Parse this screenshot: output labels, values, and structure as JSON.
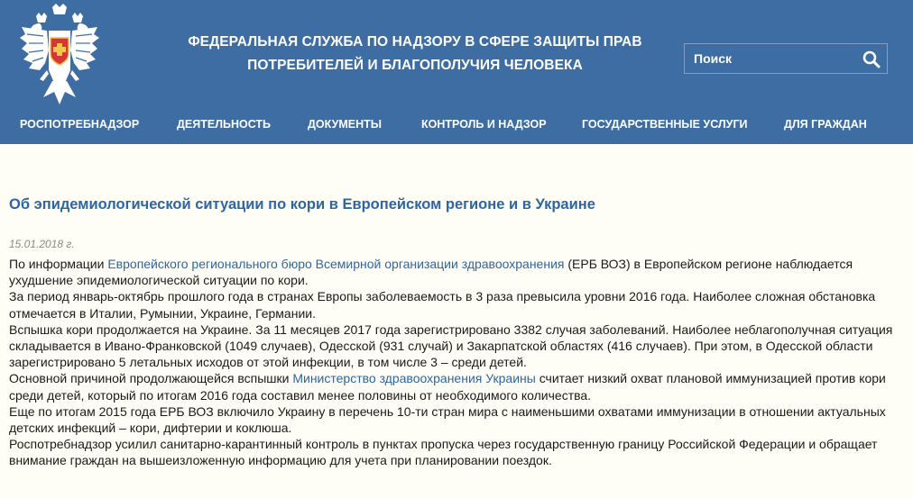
{
  "header": {
    "title_line1": "ФЕДЕРАЛЬНАЯ СЛУЖБА ПО НАДЗОРУ В СФЕРЕ ЗАЩИТЫ ПРАВ",
    "title_line2": "ПОТРЕБИТЕЛЕЙ И БЛАГОПОЛУЧИЯ ЧЕЛОВЕКА",
    "search_placeholder": "Поиск",
    "emblem_icon": "double-headed-eagle-emblem-icon",
    "search_icon": "search-icon",
    "colors": {
      "header_bg": "#3e6da3",
      "link": "#2f65a1",
      "page_bg": "#fefdf6"
    }
  },
  "nav": {
    "items": [
      {
        "label": "РОСПОТРЕБНАДЗОР"
      },
      {
        "label": "ДЕЯТЕЛЬНОСТЬ"
      },
      {
        "label": "ДОКУМЕНТЫ"
      },
      {
        "label": "КОНТРОЛЬ И НАДЗОР"
      },
      {
        "label": "ГОСУДАРСТВЕННЫЕ УСЛУГИ"
      },
      {
        "label": "ДЛЯ ГРАЖДАН"
      }
    ]
  },
  "article": {
    "title": "Об эпидемиологической ситуации по кори в Европейском регионе и в Украине",
    "date": "15.01.2018 г.",
    "p1_before": "По информации ",
    "p1_link": "Европейского регионального бюро Всемирной организации здравоохранения",
    "p1_after": " (ЕРБ ВОЗ) в Европейском регионе наблюдается ухудшение эпидемиологической ситуации по кори.",
    "p2": "За период январь-октябрь прошлого года в странах Европы заболеваемость в 3 раза превысила уровни 2016 года. Наиболее сложная обстановка отмечается в Италии, Румынии, Украине, Германии.",
    "p3": "Вспышка кори продолжается на Украине. За 11 месяцев 2017 года зарегистрировано 3382 случая заболеваний. Наиболее неблагополучная ситуация складывается в Ивано-Франковской (1049 случаев), Одесской (931 случай) и Закарпатской областях (416 случаев). При этом, в Одесской области зарегистрировано 5 летальных исходов от этой инфекции, в том числе 3 – среди детей.",
    "p4_before": "Основной причиной продолжающейся вспышки ",
    "p4_link": "Министерство здравоохранения Украины",
    "p4_after": " считает низкий охват плановой иммунизацией против кори среди детей, который по итогам 2016 года составил менее половины от необходимого количества.",
    "p5": "Еще по итогам 2015 года ЕРБ ВОЗ включило Украину в перечень 10-ти стран мира с наименьшими охватами иммунизации в отношении актуальных детских инфекций – кори, дифтерии и коклюша.",
    "p6": "Роспотребнадзор усилил санитарно-карантинный контроль в пунктах пропуска через государственную границу Российской Федерации и обращает внимание граждан на вышеизложенную информацию для учета при планировании поездок."
  }
}
